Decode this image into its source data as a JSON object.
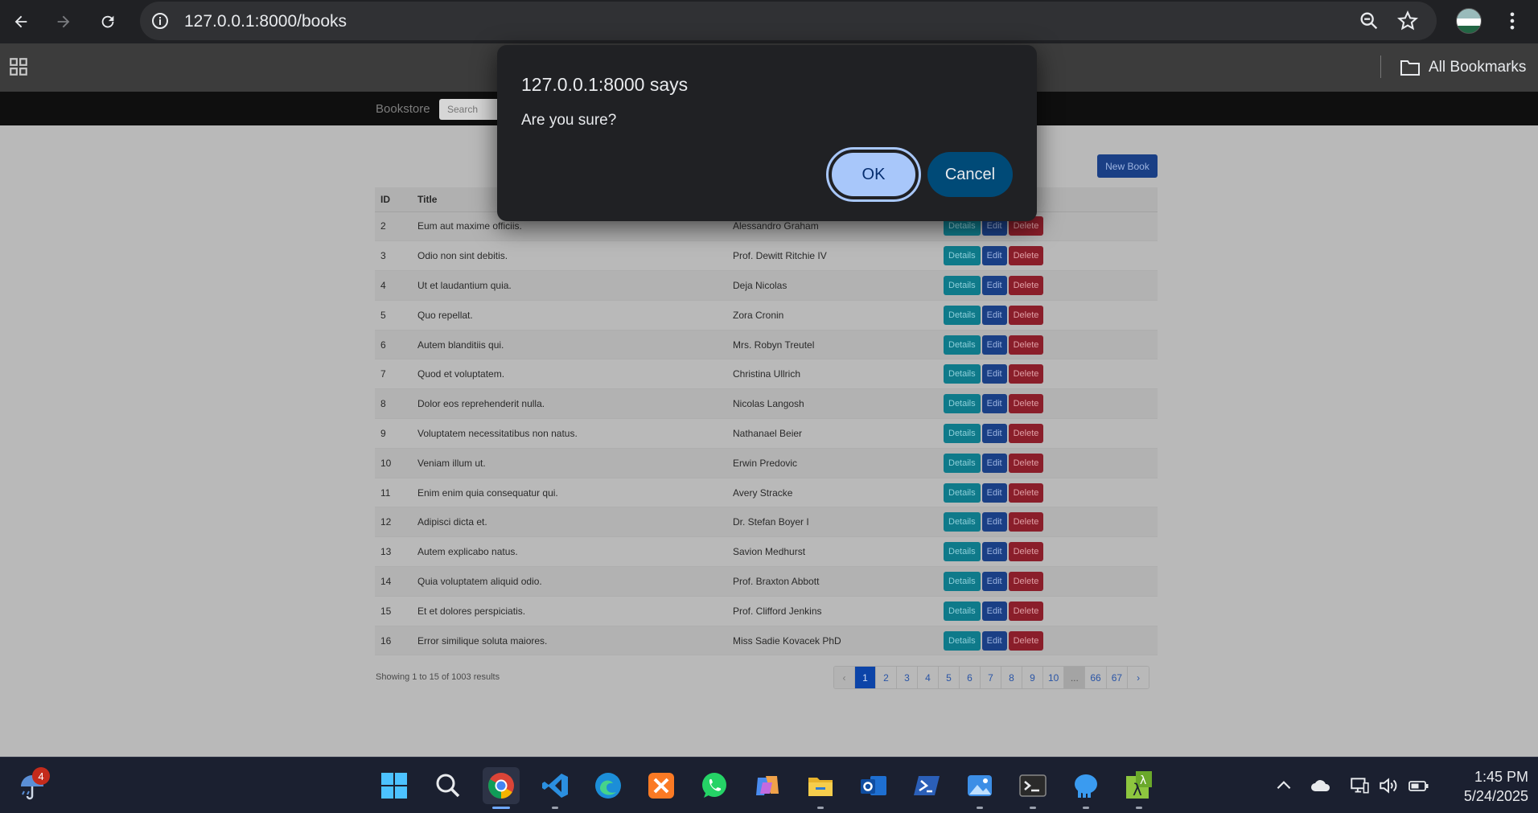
{
  "browser": {
    "url": "127.0.0.1:8000/books",
    "bookmarks_label": "All Bookmarks"
  },
  "site": {
    "brand": "Bookstore",
    "search_placeholder": "Search",
    "new_book_label": "New Book"
  },
  "table": {
    "headers": {
      "id": "ID",
      "title": "Title"
    },
    "actions": {
      "details": "Details",
      "edit": "Edit",
      "delete": "Delete"
    },
    "rows": [
      {
        "id": "2",
        "title": "Eum aut maxime officiis.",
        "author": "Alessandro Graham"
      },
      {
        "id": "3",
        "title": "Odio non sint debitis.",
        "author": "Prof. Dewitt Ritchie IV"
      },
      {
        "id": "4",
        "title": "Ut et laudantium quia.",
        "author": "Deja Nicolas"
      },
      {
        "id": "5",
        "title": "Quo repellat.",
        "author": "Zora Cronin"
      },
      {
        "id": "6",
        "title": "Autem blanditiis qui.",
        "author": "Mrs. Robyn Treutel"
      },
      {
        "id": "7",
        "title": "Quod et voluptatem.",
        "author": "Christina Ullrich"
      },
      {
        "id": "8",
        "title": "Dolor eos reprehenderit nulla.",
        "author": "Nicolas Langosh"
      },
      {
        "id": "9",
        "title": "Voluptatem necessitatibus non natus.",
        "author": "Nathanael Beier"
      },
      {
        "id": "10",
        "title": "Veniam illum ut.",
        "author": "Erwin Predovic"
      },
      {
        "id": "11",
        "title": "Enim enim quia consequatur qui.",
        "author": "Avery Stracke"
      },
      {
        "id": "12",
        "title": "Adipisci dicta et.",
        "author": "Dr. Stefan Boyer I"
      },
      {
        "id": "13",
        "title": "Autem explicabo natus.",
        "author": "Savion Medhurst"
      },
      {
        "id": "14",
        "title": "Quia voluptatem aliquid odio.",
        "author": "Prof. Braxton Abbott"
      },
      {
        "id": "15",
        "title": "Et et dolores perspiciatis.",
        "author": "Prof. Clifford Jenkins"
      },
      {
        "id": "16",
        "title": "Error similique soluta maiores.",
        "author": "Miss Sadie Kovacek PhD"
      }
    ]
  },
  "footer": {
    "showing_text": "Showing 1 to 15 of 1003 results",
    "pages": [
      "‹",
      "1",
      "2",
      "3",
      "4",
      "5",
      "6",
      "7",
      "8",
      "9",
      "10",
      "...",
      "66",
      "67",
      "›"
    ],
    "active_page": "1"
  },
  "dialog": {
    "title": "127.0.0.1:8000 says",
    "message": "Are you sure?",
    "ok_label": "OK",
    "cancel_label": "Cancel"
  },
  "taskbar": {
    "weather_badge": "4",
    "time": "1:45 PM",
    "date": "5/24/2025"
  },
  "colors": {
    "dialog_bg": "#202124",
    "ok_button": "#a8c7fa",
    "cancel_button": "#004a77",
    "details_button": "#0f7a8a",
    "edit_button": "#1a3f85",
    "delete_button": "#8a1e2a"
  }
}
